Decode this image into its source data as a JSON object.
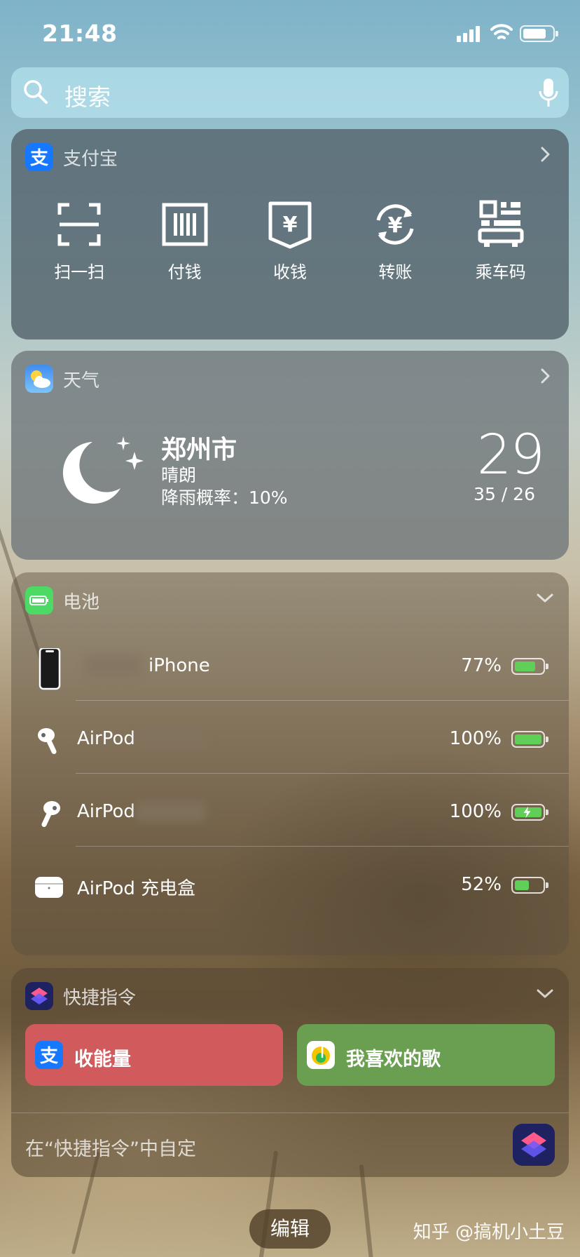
{
  "status_bar": {
    "time": "21:48"
  },
  "search": {
    "placeholder": "搜索"
  },
  "alipay": {
    "title": "支付宝",
    "actions": [
      {
        "label": "扫一扫",
        "icon": "scan-icon"
      },
      {
        "label": "付钱",
        "icon": "pay-barcode-icon"
      },
      {
        "label": "收钱",
        "icon": "receive-yuan-icon"
      },
      {
        "label": "转账",
        "icon": "transfer-yuan-icon"
      },
      {
        "label": "乘车码",
        "icon": "transit-qr-icon"
      }
    ]
  },
  "weather": {
    "title": "天气",
    "city": "郑州市",
    "condition": "晴朗",
    "rain": "降雨概率：10%",
    "temperature": "29",
    "range": "35 / 26",
    "icon": "moon-stars-icon"
  },
  "batteries": {
    "title": "电池",
    "devices": [
      {
        "name": "iPhone",
        "percent": "77%",
        "level": 0.77,
        "charging": false,
        "icon": "iphone-icon"
      },
      {
        "name": "AirPod",
        "percent": "100%",
        "level": 1.0,
        "charging": false,
        "icon": "airpod-left-icon"
      },
      {
        "name": "AirPod",
        "percent": "100%",
        "level": 1.0,
        "charging": true,
        "icon": "airpod-right-icon"
      },
      {
        "name": "AirPod 充电盒",
        "percent": "52%",
        "level": 0.52,
        "charging": false,
        "icon": "airpod-case-icon"
      }
    ]
  },
  "shortcuts": {
    "title": "快捷指令",
    "items": [
      {
        "label": "收能量",
        "color": "#d05a5c",
        "icon": "alipay-icon"
      },
      {
        "label": "我喜欢的歌",
        "color": "#6a9e50",
        "icon": "qqmusic-icon"
      }
    ],
    "customize": "在“快捷指令”中自定"
  },
  "edit_label": "编辑",
  "watermark": "知乎 @搞机小土豆",
  "colors": {
    "alipay_blue": "#1677ff",
    "battery_green": "#5fcf58",
    "battery_app": "#4cd964"
  }
}
